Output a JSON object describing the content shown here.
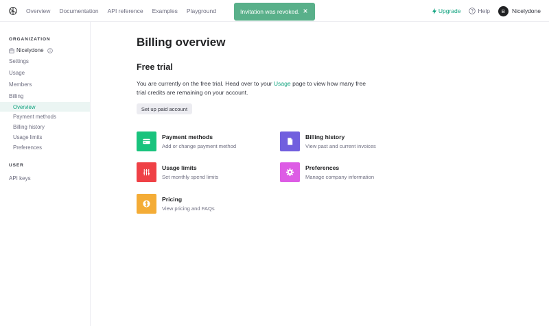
{
  "nav": {
    "links": [
      "Overview",
      "Documentation",
      "API reference",
      "Examples",
      "Playground"
    ],
    "upgrade": "Upgrade",
    "help": "Help",
    "user_initial": "B",
    "user_name": "Nicelydone"
  },
  "toast": {
    "message": "Invitation was revoked."
  },
  "sidebar": {
    "org_label": "ORGANIZATION",
    "org_name": "Nicelydone",
    "items": [
      "Settings",
      "Usage",
      "Members",
      "Billing"
    ],
    "billing_sub": [
      "Overview",
      "Payment methods",
      "Billing history",
      "Usage limits",
      "Preferences"
    ],
    "user_label": "USER",
    "user_items": [
      "API keys"
    ]
  },
  "main": {
    "title": "Billing overview",
    "trial_title": "Free trial",
    "para_before": "You are currently on the free trial. Head over to your ",
    "para_link": "Usage",
    "para_after": " page to view how many free trial credits are remaining on your account.",
    "button": "Set up paid account",
    "cards": [
      {
        "title": "Payment methods",
        "desc": "Add or change payment method",
        "icon": "credit-card-icon",
        "color": "#19c37d"
      },
      {
        "title": "Billing history",
        "desc": "View past and current invoices",
        "icon": "document-icon",
        "color": "#715fde"
      },
      {
        "title": "Usage limits",
        "desc": "Set monthly spend limits",
        "icon": "sliders-icon",
        "color": "#ef4146"
      },
      {
        "title": "Preferences",
        "desc": "Manage company information",
        "icon": "gear-icon",
        "color": "#dd5ce5"
      },
      {
        "title": "Pricing",
        "desc": "View pricing and FAQs",
        "icon": "dollar-icon",
        "color": "#f4ac36"
      }
    ]
  }
}
